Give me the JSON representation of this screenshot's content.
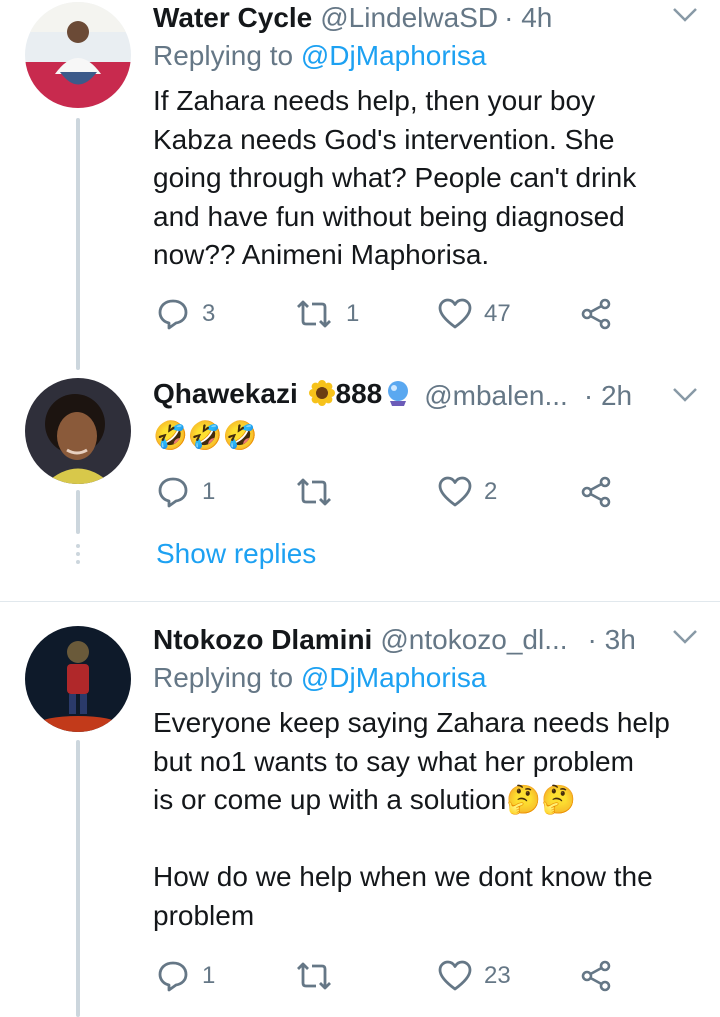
{
  "tweets": [
    {
      "name": "Water Cycle",
      "handle": "@LindelwaSD",
      "time": "· 4h",
      "replying_prefix": "Replying to",
      "replying_to": "@DjMaphorisa",
      "text": "If Zahara needs help, then your boy\nKabza needs God's intervention. She\ngoing through what? People can't drink\nand have fun without being diagnosed\nnow?? Animeni Maphorisa.",
      "replies": "3",
      "retweets": "1",
      "likes": "47"
    },
    {
      "name": "Qhawekazi",
      "name_suffix": "888",
      "handle": "@mbalen...",
      "time": "· 2h",
      "text": "🤣🤣🤣",
      "replies": "1",
      "retweets": "",
      "likes": "2",
      "show_replies": "Show replies"
    },
    {
      "name": "Ntokozo Dlamini",
      "handle": "@ntokozo_dl...",
      "time": "· 3h",
      "replying_prefix": "Replying to",
      "replying_to": "@DjMaphorisa",
      "text": "Everyone keep saying Zahara needs help\nbut no1 wants to say what her problem\nis or come up with a solution🤔🤔\n\nHow do we help when we dont know the\nproblem",
      "replies": "1",
      "retweets": "",
      "likes": "23"
    }
  ],
  "icons": {
    "reply": "reply-icon",
    "retweet": "retweet-icon",
    "like": "heart-icon",
    "share": "share-icon",
    "more": "chevron-down-icon"
  },
  "colors": {
    "link": "#1da1f2",
    "secondary_text": "#657786",
    "thread_line": "#ccd6dd"
  }
}
